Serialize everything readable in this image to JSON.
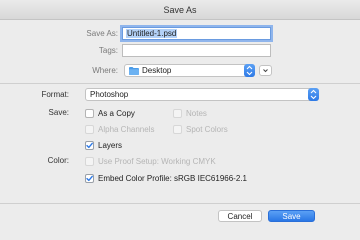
{
  "window": {
    "title": "Save As"
  },
  "fields": {
    "save_as": {
      "label": "Save As:",
      "value": "Untitled-1.psd"
    },
    "tags": {
      "label": "Tags:",
      "value": ""
    },
    "where": {
      "label": "Where:",
      "value": "Desktop",
      "icon": "folder-icon"
    }
  },
  "options": {
    "format": {
      "label": "Format:",
      "value": "Photoshop"
    },
    "save_label": "Save:",
    "color_label": "Color:",
    "checkboxes": {
      "as_a_copy": {
        "label": "As a Copy",
        "checked": false,
        "enabled": true
      },
      "notes": {
        "label": "Notes",
        "checked": false,
        "enabled": false
      },
      "alpha_channels": {
        "label": "Alpha Channels",
        "checked": false,
        "enabled": false
      },
      "spot_colors": {
        "label": "Spot Colors",
        "checked": false,
        "enabled": false
      },
      "layers": {
        "label": "Layers",
        "checked": true,
        "enabled": true
      },
      "use_proof_setup": {
        "label": "Use Proof Setup:  Working CMYK",
        "checked": false,
        "enabled": false
      },
      "embed_color_profile": {
        "label": "Embed Color Profile:  sRGB IEC61966-2.1",
        "checked": true,
        "enabled": true
      }
    }
  },
  "buttons": {
    "cancel": "Cancel",
    "save": "Save"
  },
  "colors": {
    "accent": "#2d79e6",
    "background": "#ececec"
  }
}
